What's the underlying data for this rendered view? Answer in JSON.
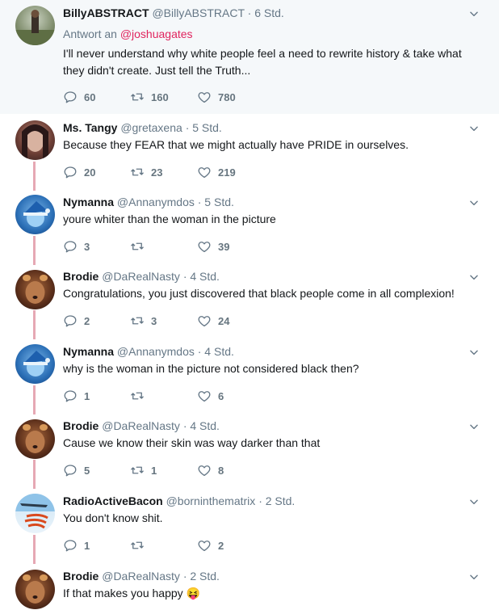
{
  "theme": {
    "accent": "#e0245e",
    "thread_line": "#e6a8b4",
    "muted": "#657786"
  },
  "tweets": [
    {
      "name": "BillyABSTRACT",
      "handle": "@BillyABSTRACT",
      "time": "· 6 Std.",
      "reply_label": "Antwort an",
      "reply_to": "@joshuagates",
      "text": "I'll never understand why white people feel a need to rewrite history & take what they didn't create. Just tell the Truth...",
      "replies": "60",
      "retweets": "160",
      "likes": "780"
    },
    {
      "name": "Ms. Tangy",
      "handle": "@gretaxena",
      "time": "· 5 Std.",
      "text": "Because they FEAR that we might actually have PRIDE in ourselves.",
      "replies": "20",
      "retweets": "23",
      "likes": "219"
    },
    {
      "name": "Nymanna",
      "handle": "@Annanymdos",
      "time": "· 5 Std.",
      "text": "youre whiter than the woman in the picture",
      "replies": "3",
      "retweets": "",
      "likes": "39"
    },
    {
      "name": "Brodie",
      "handle": "@DaRealNasty",
      "time": "· 4 Std.",
      "text": "Congratulations, you just discovered that black people come in all complexion!",
      "replies": "2",
      "retweets": "3",
      "likes": "24"
    },
    {
      "name": "Nymanna",
      "handle": "@Annanymdos",
      "time": "· 4 Std.",
      "text": "why is the woman in the picture not considered black then?",
      "replies": "1",
      "retweets": "",
      "likes": "6"
    },
    {
      "name": "Brodie",
      "handle": "@DaRealNasty",
      "time": "· 4 Std.",
      "text": "Cause we know their skin was way darker than that",
      "replies": "5",
      "retweets": "1",
      "likes": "8"
    },
    {
      "name": "RadioActiveBacon",
      "handle": "@borninthematrix",
      "time": "· 2 Std.",
      "text": "You don't know shit.",
      "replies": "1",
      "retweets": "",
      "likes": "2"
    },
    {
      "name": "Brodie",
      "handle": "@DaRealNasty",
      "time": "· 2 Std.",
      "text": "If that makes you happy 😝",
      "replies": "",
      "retweets": "",
      "likes": ""
    }
  ]
}
